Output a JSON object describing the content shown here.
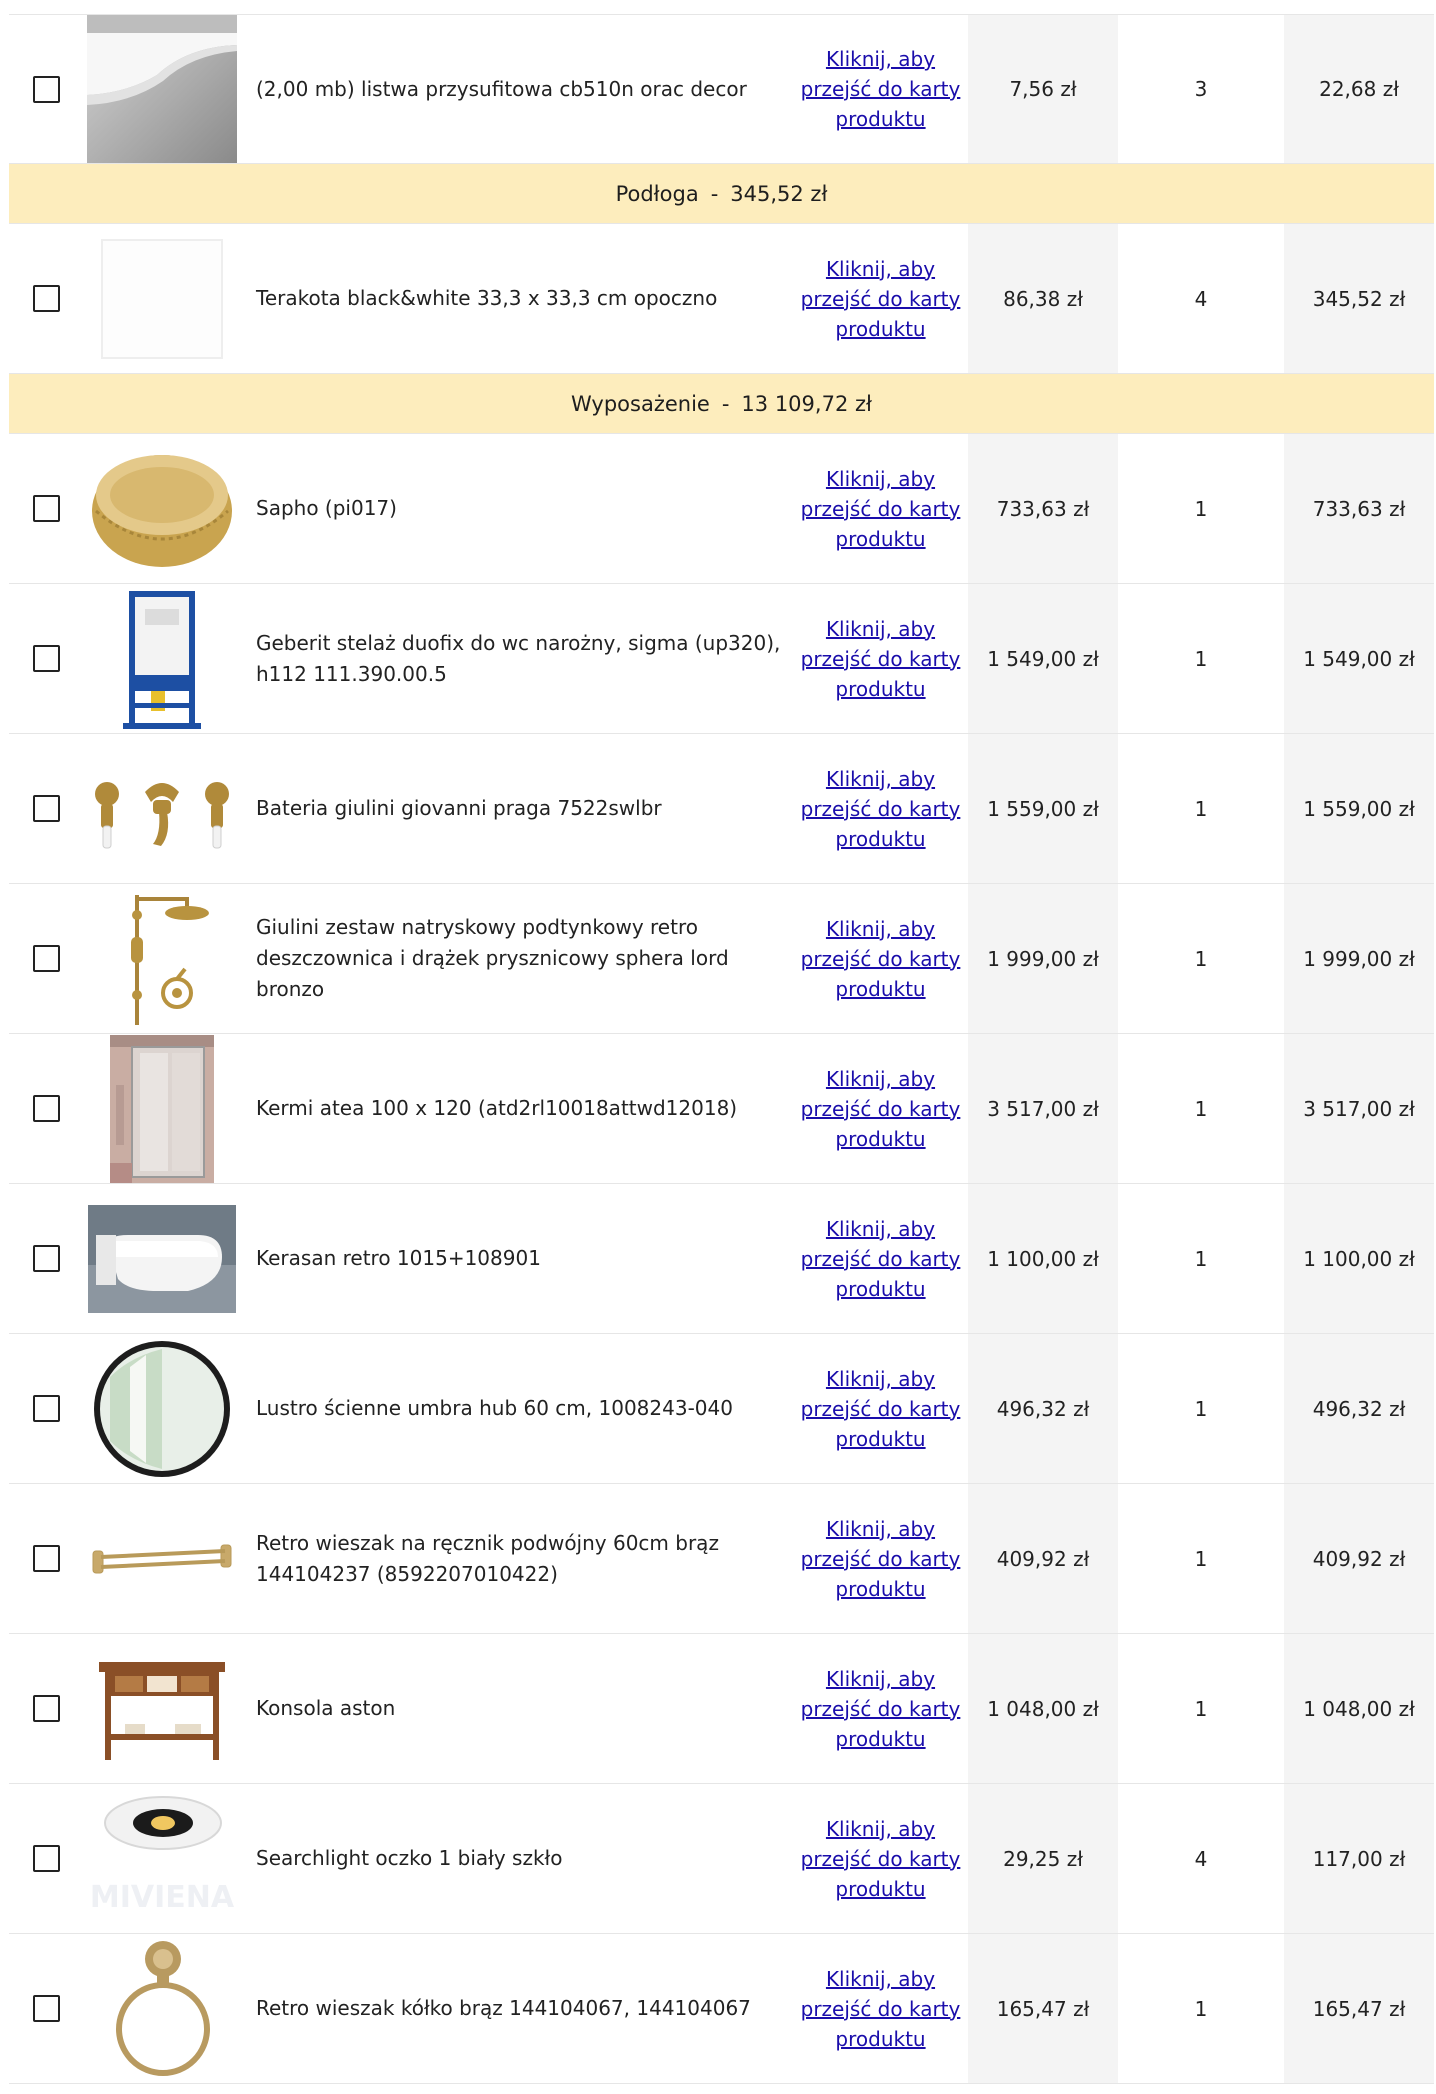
{
  "link_text": "Kliknij, aby przejść do karty produktu",
  "rows": [
    {
      "type": "item",
      "icon": "cornice-molding-image",
      "name": "(2,00 mb) listwa przysufitowa cb510n orac decor",
      "price": "7,56 zł",
      "qty": "3",
      "total": "22,68 zł"
    },
    {
      "type": "category",
      "name": "Podłoga",
      "sep": "-",
      "total": "345,52 zł"
    },
    {
      "type": "item",
      "icon": "white-tile-image",
      "name": "Terakota black&white 33,3 x 33,3 cm opoczno",
      "price": "86,38 zł",
      "qty": "4",
      "total": "345,52 zł"
    },
    {
      "type": "category",
      "name": "Wyposażenie",
      "sep": "-",
      "total": "13 109,72 zł"
    },
    {
      "type": "item",
      "icon": "washbasin-bowl-image",
      "name": "Sapho   (pi017)",
      "price": "733,63 zł",
      "qty": "1",
      "total": "733,63 zł"
    },
    {
      "type": "item",
      "icon": "wc-frame-image",
      "name": "Geberit  stelaż duofix do wc narożny, sigma (up320), h112 111.390.00.5",
      "price": "1 549,00 zł",
      "qty": "1",
      "total": "1 549,00 zł"
    },
    {
      "type": "item",
      "icon": "wall-faucet-image",
      "name": "Bateria giulini giovanni praga 7522swlbr",
      "price": "1 559,00 zł",
      "qty": "1",
      "total": "1 559,00 zł"
    },
    {
      "type": "item",
      "icon": "shower-set-image",
      "name": "Giulini zestaw natryskowy podtynkowy retro deszczownica i drążek prysznicowy sphera lord bronzo",
      "price": "1 999,00 zł",
      "qty": "1",
      "total": "1 999,00 zł"
    },
    {
      "type": "item",
      "icon": "shower-enclosure-image",
      "name": "Kermi atea  100 x 120 (atd2rl10018attwd12018)",
      "price": "3 517,00 zł",
      "qty": "1",
      "total": "3 517,00 zł"
    },
    {
      "type": "item",
      "icon": "wall-toilet-image",
      "name": "Kerasan  retro 1015+108901",
      "price": "1 100,00 zł",
      "qty": "1",
      "total": "1 100,00 zł"
    },
    {
      "type": "item",
      "icon": "round-mirror-image",
      "name": "Lustro ścienne umbra hub 60 cm, 1008243-040",
      "price": "496,32 zł",
      "qty": "1",
      "total": "496,32 zł"
    },
    {
      "type": "item",
      "icon": "towel-rail-image",
      "name": "Retro wieszak na ręcznik podwójny 60cm brąz 144104237 (8592207010422)",
      "price": "409,92 zł",
      "qty": "1",
      "total": "409,92 zł"
    },
    {
      "type": "item",
      "icon": "console-table-image",
      "name": "Konsola aston",
      "price": "1 048,00 zł",
      "qty": "1",
      "total": "1 048,00 zł"
    },
    {
      "type": "item",
      "icon": "downlight-image",
      "name": "Searchlight oczko 1 biały szkło",
      "price": "29,25 zł",
      "qty": "4",
      "total": "117,00 zł"
    },
    {
      "type": "item",
      "icon": "towel-ring-image",
      "name": "Retro wieszak kółko brąz 144104067, 144104067",
      "price": "165,47 zł",
      "qty": "1",
      "total": "165,47 zł"
    }
  ]
}
